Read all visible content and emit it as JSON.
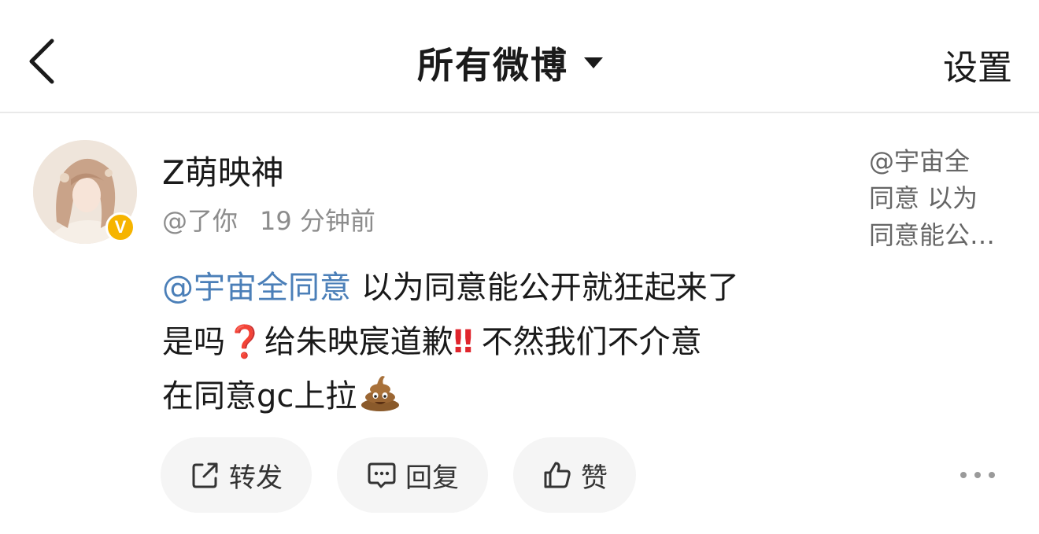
{
  "header": {
    "title": "所有微博",
    "settings_label": "设置"
  },
  "post": {
    "username": "Z萌映神",
    "handle": "@了你",
    "time": "19 分钟前",
    "mention": "@宇宙全同意",
    "text_line1_rest": " 以为同意能公开就狂起来了",
    "text_line2_a": "是吗",
    "emoji_question": "❓",
    "text_line2_b": "给朱映宸道歉",
    "emoji_exclaim": "‼",
    "text_line2_c": " 不然我们不介意",
    "text_line3": "在同意gc上拉",
    "poo_icon": "pile-of-poo-emoji",
    "verified_badge": "V",
    "quoted": {
      "line1": "@宇宙全",
      "line2": "同意 以为",
      "line3": "同意能公…"
    }
  },
  "actions": {
    "repost_label": "转发",
    "reply_label": "回复",
    "like_label": "赞"
  },
  "colors": {
    "mention": "#4b7fb8",
    "badge": "#f6b400",
    "button_bg": "#f5f5f5"
  }
}
